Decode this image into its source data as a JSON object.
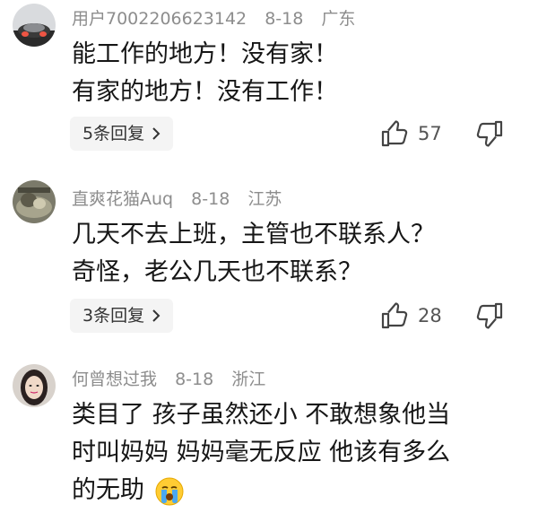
{
  "comments": [
    {
      "username": "用户7002206623142",
      "date": "8-18",
      "location": "广东",
      "lines": [
        "能工作的地方！没有家！",
        "有家的地方！没有工作！"
      ],
      "replies_label": "5条回复",
      "likes": "57"
    },
    {
      "username": "直爽花猫Auq",
      "date": "8-18",
      "location": "江苏",
      "lines": [
        "几天不去上班，主管也不联系人？",
        "奇怪，老公几天也不联系？"
      ],
      "replies_label": "3条回复",
      "likes": "28"
    },
    {
      "username": "何曾想过我",
      "date": "8-18",
      "location": "浙江",
      "lines": [
        "类目了 孩子虽然还小 不敢想象他当",
        "时叫妈妈 妈妈毫无反应 他该有多么",
        "的无助"
      ]
    }
  ],
  "icons": {
    "like": "thumbs-up-icon",
    "dislike": "thumbs-down-icon",
    "reply_chevron": "chevron-right-icon",
    "crying_emoji": "crying-face-emoji"
  },
  "colors": {
    "meta_text": "#8d8d8d",
    "reply_bg": "#f4f4f4"
  }
}
